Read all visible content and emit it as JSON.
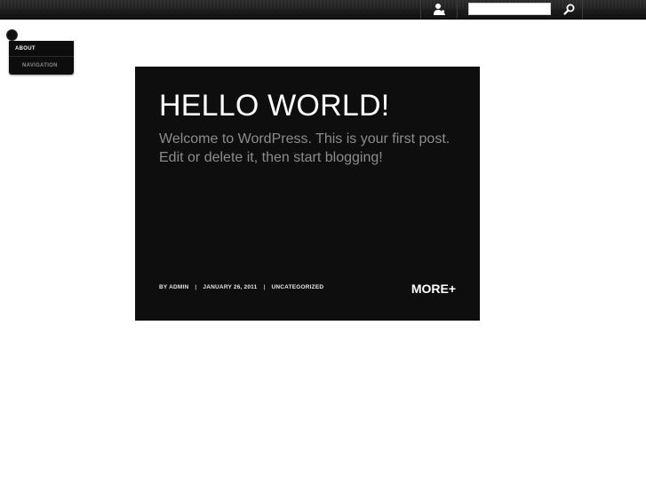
{
  "topbar": {
    "search": {
      "value": "",
      "placeholder": ""
    },
    "icons": {
      "user": "user-icon",
      "search": "search-icon"
    }
  },
  "menu": {
    "items": [
      {
        "label": "ABOUT"
      },
      {
        "label": "NAVIGATION"
      }
    ]
  },
  "post": {
    "title": "HELLO WORLD!",
    "excerpt": "Welcome to WordPress. This is your first post. Edit or delete it, then start blogging!",
    "meta": {
      "author": "BY ADMIN",
      "date": "JANUARY 26, 2011",
      "category": "UNCATEGORIZED",
      "separator": "|"
    },
    "more_label": "MORE+"
  },
  "colors": {
    "card_background": "#0e0e0e",
    "excerpt_text": "#8c8c8c",
    "topbar": "#1a1a1a"
  }
}
